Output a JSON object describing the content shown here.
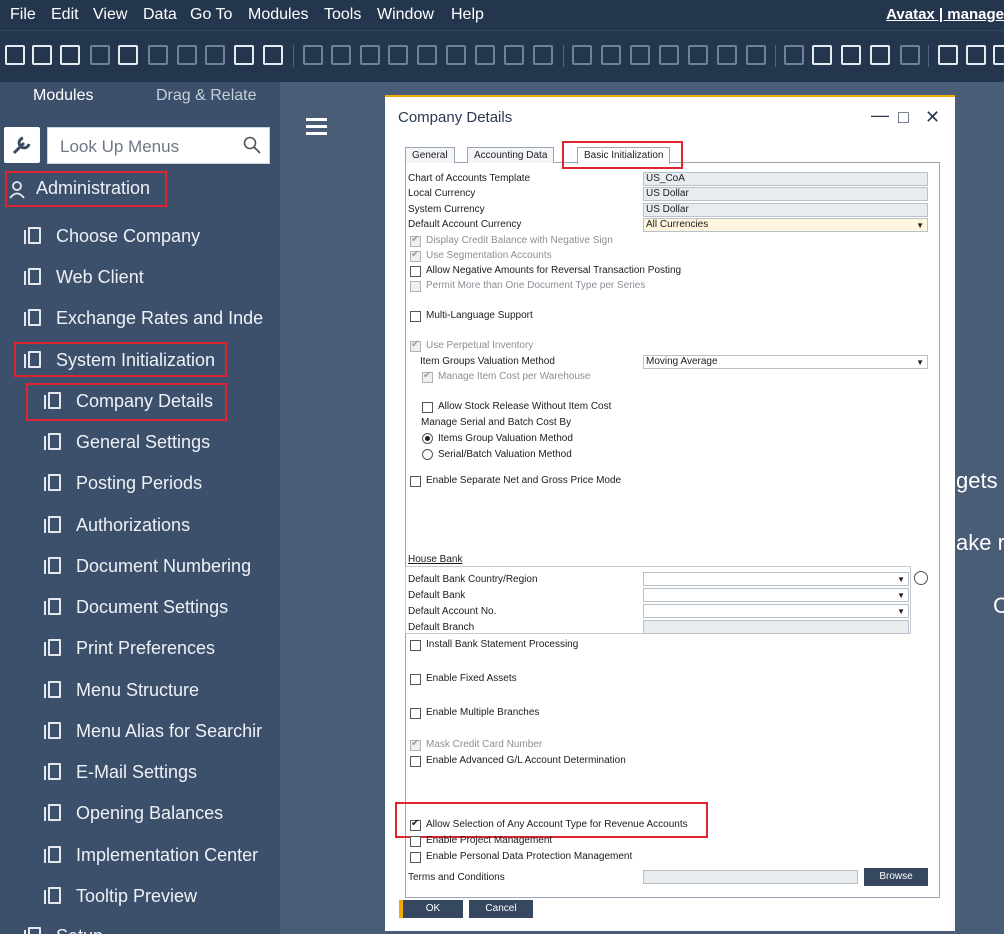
{
  "menubar": {
    "items": [
      "File",
      "Edit",
      "View",
      "Data",
      "Go To",
      "Modules",
      "Tools",
      "Window",
      "Help"
    ],
    "right_text": "Avatax | manage"
  },
  "sidebar": {
    "tabs": {
      "modules": "Modules",
      "drag": "Drag & Relate"
    },
    "lookup_placeholder": "Look Up Menus",
    "items": [
      "Administration",
      "Choose Company",
      "Web Client",
      "Exchange Rates and Inde",
      "System Initialization",
      "Company Details",
      "General Settings",
      "Posting Periods",
      "Authorizations",
      "Document Numbering",
      "Document Settings",
      "Print Preferences",
      "Menu Structure",
      "Menu Alias for Searchir",
      "E-Mail Settings",
      "Opening Balances",
      "Implementation Center",
      "Tooltip Preview",
      "Setup"
    ]
  },
  "background_text": [
    "gets to",
    "ake re",
    "C"
  ],
  "dialog": {
    "title": "Company Details",
    "tabs": [
      "General",
      "Accounting Data",
      "Basic Initialization"
    ],
    "fields": {
      "chart_label": "Chart of Accounts Template",
      "chart_value": "US_CoA",
      "local_label": "Local Currency",
      "local_value": "US Dollar",
      "system_label": "System Currency",
      "system_value": "US Dollar",
      "default_acct_label": "Default Account Currency",
      "default_acct_value": "All Currencies"
    },
    "checks": {
      "display_credit": "Display Credit Balance with Negative Sign",
      "segmentation": "Use Segmentation Accounts",
      "negative_amounts": "Allow Negative Amounts for Reversal Transaction Posting",
      "permit_multi": "Permit More than One Document Type per Series",
      "multilang": "Multi-Language Support",
      "perpetual": "Use Perpetual Inventory",
      "manage_cost_wh": "Manage Item Cost per Warehouse",
      "stock_release": "Allow Stock Release Without Item Cost",
      "separate_net": "Enable Separate Net and Gross Price Mode",
      "bank_statement": "Install Bank Statement Processing",
      "fixed_assets": "Enable Fixed Assets",
      "branches": "Enable Multiple Branches",
      "mask_cc": "Mask Credit Card Number",
      "adv_gl": "Enable Advanced G/L Account Determination",
      "any_acct": "Allow Selection of Any Account Type for Revenue Accounts",
      "project": "Enable Project Management",
      "personal": "Enable Personal Data Protection Management"
    },
    "valuation_label": "Item Groups Valuation Method",
    "valuation_value": "Moving Average",
    "serial_label": "Manage Serial and Batch Cost By",
    "radio_items_group": "Items Group Valuation Method",
    "radio_serial": "Serial/Batch Valuation Method",
    "house_bank": "House Bank",
    "bank_country": "Default Bank Country/Region",
    "bank": "Default Bank",
    "account_no": "Default Account No.",
    "branch": "Default Branch",
    "terms": "Terms and Conditions",
    "browse": "Browse",
    "ok": "OK",
    "cancel": "Cancel"
  }
}
